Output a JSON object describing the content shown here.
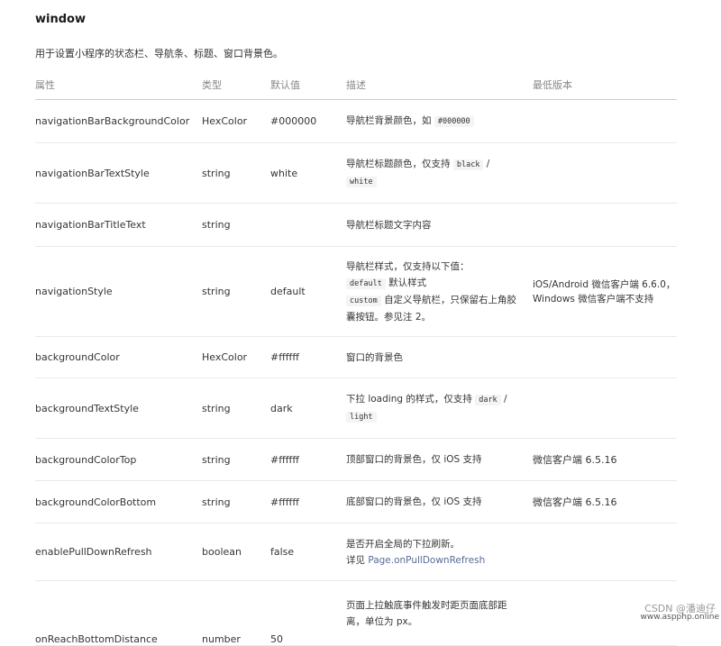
{
  "section": {
    "title": "window",
    "description": "用于设置小程序的状态栏、导航条、标题、窗口背景色。"
  },
  "table": {
    "headers": [
      "属性",
      "类型",
      "默认值",
      "描述",
      "最低版本"
    ],
    "rows": [
      {
        "prop": "navigationBarBackgroundColor",
        "type": "HexColor",
        "default": "#000000",
        "desc_text": "导航栏背景颜色，如",
        "desc_code": "#000000",
        "version": ""
      },
      {
        "prop": "navigationBarTextStyle",
        "type": "string",
        "default": "white",
        "desc_text": "导航栏标题颜色，仅支持",
        "desc_code1": "black",
        "desc_sep": "/",
        "desc_code2": "white",
        "version": ""
      },
      {
        "prop": "navigationBarTitleText",
        "type": "string",
        "default": "",
        "desc_text": "导航栏标题文字内容",
        "version": ""
      },
      {
        "prop": "navigationStyle",
        "type": "string",
        "default": "default",
        "desc_line1": "导航栏样式，仅支持以下值：",
        "desc_code1": "default",
        "desc_text1": "默认样式",
        "desc_code2": "custom",
        "desc_text2": "自定义导航栏，只保留右上角胶囊按钮。参见注 2。",
        "version_line1": "iOS/Android 微信客户端 6.6.0，",
        "version_line2": "Windows 微信客户端不支持"
      },
      {
        "prop": "backgroundColor",
        "type": "HexColor",
        "default": "#ffffff",
        "desc_text": "窗口的背景色",
        "version": ""
      },
      {
        "prop": "backgroundTextStyle",
        "type": "string",
        "default": "dark",
        "desc_text": "下拉 loading 的样式，仅支持",
        "desc_code1": "dark",
        "desc_sep": "/",
        "desc_code2": "light",
        "version": ""
      },
      {
        "prop": "backgroundColorTop",
        "type": "string",
        "default": "#ffffff",
        "desc_text": "顶部窗口的背景色，仅 iOS 支持",
        "version": "微信客户端 6.5.16"
      },
      {
        "prop": "backgroundColorBottom",
        "type": "string",
        "default": "#ffffff",
        "desc_text": "底部窗口的背景色，仅 iOS 支持",
        "version": "微信客户端 6.5.16"
      },
      {
        "prop": "enablePullDownRefresh",
        "type": "boolean",
        "default": "false",
        "desc_line1": "是否开启全局的下拉刷新。",
        "desc_prefix": "详见",
        "desc_link": "Page.onPullDownRefresh",
        "version": ""
      },
      {
        "prop": "onReachBottomDistance",
        "type": "number",
        "default": "50",
        "desc_text": "页面上拉触底事件触发时距页面底部距离，单位为 px。",
        "version": ""
      }
    ]
  },
  "watermark": {
    "text": "CSDN @潘迪仔",
    "site": "www.aspphp.online"
  }
}
